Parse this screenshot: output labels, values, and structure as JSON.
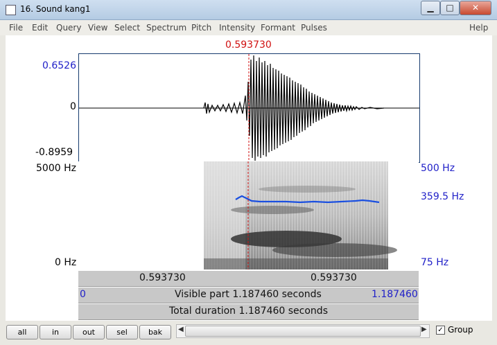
{
  "window": {
    "title": "16. Sound kang1",
    "min_label": "▁",
    "max_label": "□",
    "close_label": "✕"
  },
  "menu": [
    "File",
    "Edit",
    "Query",
    "View",
    "Select",
    "Spectrum",
    "Pitch",
    "Intensity",
    "Formant",
    "Pulses",
    "Help"
  ],
  "cursor": {
    "time": "0.593730",
    "color": "#d01010"
  },
  "waveform": {
    "max": "0.6526",
    "zero": "0",
    "min": "-0.8959"
  },
  "spectrogram": {
    "freq_top": "5000 Hz",
    "freq_bottom": "0 Hz"
  },
  "pitch": {
    "top": "500 Hz",
    "cursor_value": "359.5 Hz",
    "bottom": "75 Hz",
    "color": "#1a4fe0"
  },
  "selection_bar": {
    "left": "0.593730",
    "right": "0.593730"
  },
  "visible_bar": {
    "start": "0",
    "label": "Visible part 1.187460 seconds",
    "end": "1.187460"
  },
  "total_bar": {
    "label": "Total duration 1.187460 seconds"
  },
  "buttons": {
    "all": "all",
    "in": "in",
    "out": "out",
    "sel": "sel",
    "bak": "bak"
  },
  "group": {
    "label": "Group",
    "checked": "✓"
  },
  "scroll": {
    "left_arrow": "◀",
    "right_arrow": "▶"
  }
}
